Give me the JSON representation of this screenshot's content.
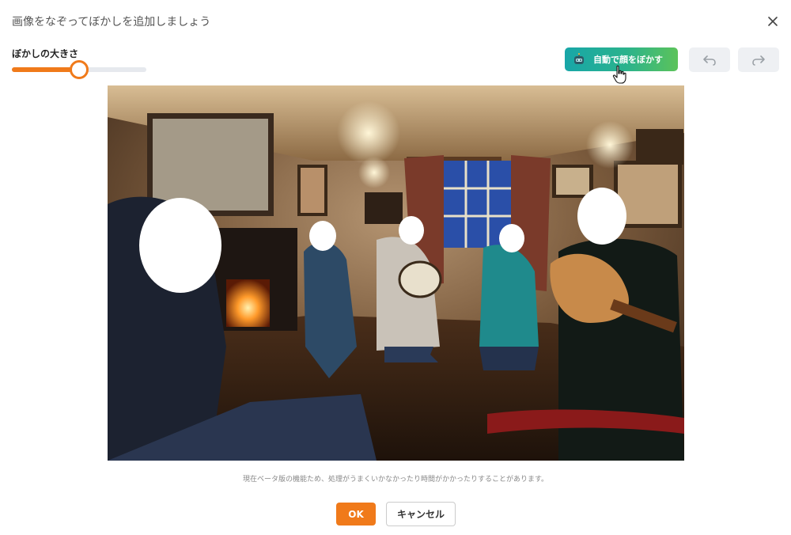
{
  "dialog": {
    "title": "画像をなぞってぼかしを追加しましょう",
    "close_icon": "close-icon"
  },
  "slider": {
    "label": "ぼかしの大きさ",
    "value_percent": 50
  },
  "toolbar": {
    "auto_blur_label": "自動で顔をぼかす",
    "auto_blur_icon": "robot-icon",
    "undo_icon": "undo-icon",
    "redo_icon": "redo-icon"
  },
  "image": {
    "description": "photo-editing-canvas"
  },
  "note": "現在ベータ版の機能ため、処理がうまくいかなかったり時間がかかったりすることがあります。",
  "actions": {
    "ok_label": "OK",
    "cancel_label": "キャンセル"
  },
  "colors": {
    "accent": "#f07a1a",
    "auto_blur_gradient_start": "#18a6a8",
    "auto_blur_gradient_end": "#5cc35a",
    "history_button_bg": "#eef0f3"
  }
}
